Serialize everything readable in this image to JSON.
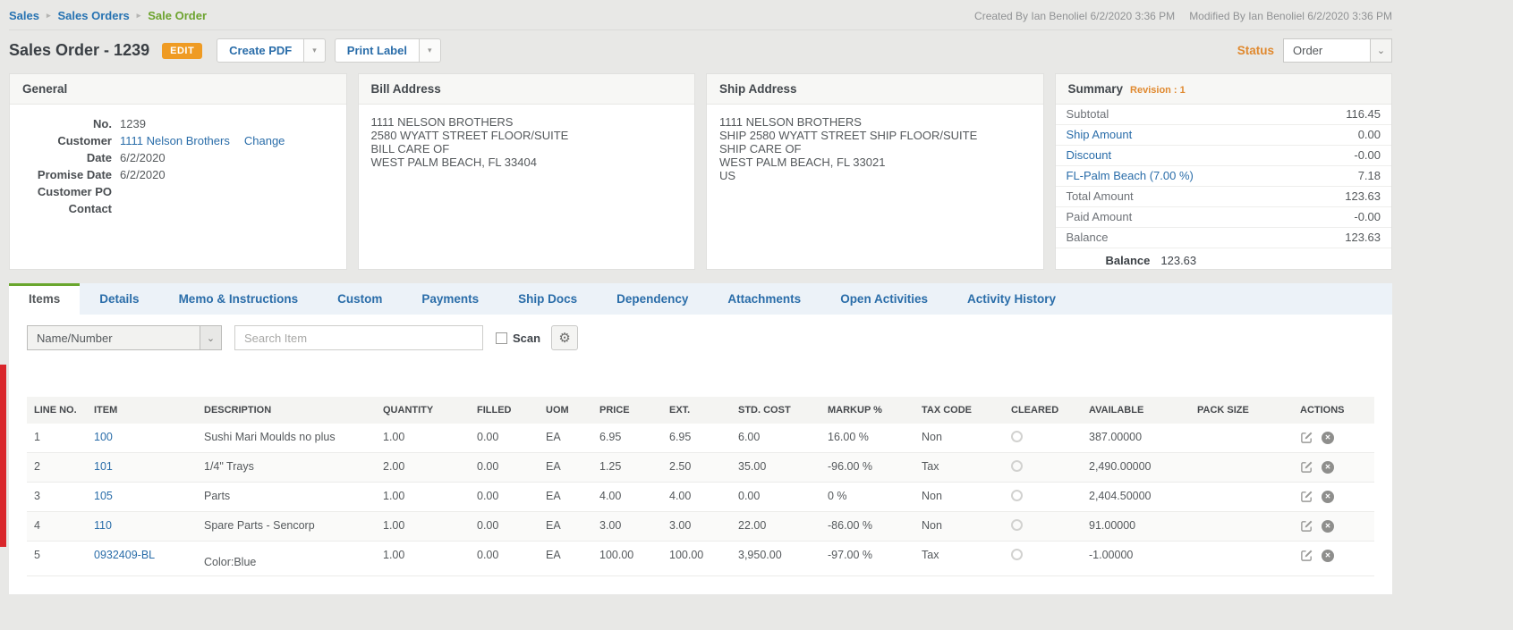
{
  "breadcrumb": {
    "items": [
      {
        "label": "Sales"
      },
      {
        "label": "Sales Orders"
      },
      {
        "label": "Sale Order"
      }
    ]
  },
  "meta": {
    "created": "Created By Ian Benoliel 6/2/2020 3:36 PM",
    "modified": "Modified By Ian Benoliel 6/2/2020 3:36 PM"
  },
  "header": {
    "title": "Sales Order - 1239",
    "edit_badge": "EDIT",
    "create_pdf_label": "Create PDF",
    "print_label_label": "Print Label",
    "status_label": "Status",
    "status_value": "Order"
  },
  "general": {
    "title": "General",
    "no": {
      "label": "No.",
      "value": "1239"
    },
    "customer": {
      "label": "Customer",
      "value": "1111 Nelson Brothers",
      "change_label": "Change"
    },
    "date": {
      "label": "Date",
      "value": "6/2/2020"
    },
    "promise_date": {
      "label": "Promise Date",
      "value": "6/2/2020"
    },
    "customer_po": {
      "label": "Customer PO",
      "value": ""
    },
    "contact": {
      "label": "Contact",
      "value": ""
    }
  },
  "bill_address": {
    "title": "Bill Address",
    "lines": [
      "1111 NELSON BROTHERS",
      "2580 WYATT STREET FLOOR/SUITE",
      "BILL CARE OF",
      "WEST PALM BEACH, FL 33404"
    ]
  },
  "ship_address": {
    "title": "Ship Address",
    "lines": [
      "1111 NELSON BROTHERS",
      "SHIP 2580 WYATT STREET SHIP FLOOR/SUITE",
      "SHIP CARE OF",
      "WEST PALM BEACH, FL 33021",
      "US"
    ]
  },
  "summary": {
    "title": "Summary",
    "revision": "Revision : 1",
    "rows": [
      {
        "label": "Subtotal",
        "value": "116.45",
        "link": false
      },
      {
        "label": "Ship Amount",
        "value": "0.00",
        "link": true
      },
      {
        "label": "Discount",
        "value": "-0.00",
        "link": true
      },
      {
        "label": "FL-Palm Beach (7.00 %)",
        "value": "7.18",
        "link": true
      },
      {
        "label": "Total Amount",
        "value": "123.63",
        "link": false
      },
      {
        "label": "Paid Amount",
        "value": "-0.00",
        "link": false
      },
      {
        "label": "Balance",
        "value": "123.63",
        "link": false
      }
    ],
    "balance_label": "Balance",
    "balance_value": "123.63"
  },
  "tabs": {
    "items": [
      {
        "label": "Items",
        "active": true
      },
      {
        "label": "Details",
        "active": false
      },
      {
        "label": "Memo & Instructions",
        "active": false
      },
      {
        "label": "Custom",
        "active": false
      },
      {
        "label": "Payments",
        "active": false
      },
      {
        "label": "Ship Docs",
        "active": false
      },
      {
        "label": "Dependency",
        "active": false
      },
      {
        "label": "Attachments",
        "active": false
      },
      {
        "label": "Open Activities",
        "active": false
      },
      {
        "label": "Activity History",
        "active": false
      }
    ]
  },
  "toolbar": {
    "filter_value": "Name/Number",
    "search_placeholder": "Search Item",
    "scan_label": "Scan"
  },
  "items_table": {
    "columns": [
      "LINE NO.",
      "ITEM",
      "DESCRIPTION",
      "QUANTITY",
      "FILLED",
      "UOM",
      "PRICE",
      "EXT.",
      "STD. COST",
      "MARKUP %",
      "TAX CODE",
      "CLEARED",
      "AVAILABLE",
      "PACK SIZE",
      "ACTIONS"
    ],
    "rows": [
      {
        "line_no": "1",
        "item": "100",
        "description": "Sushi Mari Moulds no plus",
        "description2": "",
        "quantity": "1.00",
        "filled": "0.00",
        "uom": "EA",
        "price": "6.95",
        "ext": "6.95",
        "std_cost": "6.00",
        "markup": "16.00 %",
        "tax_code": "Non",
        "available": "387.00000",
        "pack_size": ""
      },
      {
        "line_no": "2",
        "item": "101",
        "description": "1/4\" Trays",
        "description2": "",
        "quantity": "2.00",
        "filled": "0.00",
        "uom": "EA",
        "price": "1.25",
        "ext": "2.50",
        "std_cost": "35.00",
        "markup": "-96.00 %",
        "tax_code": "Tax",
        "available": "2,490.00000",
        "pack_size": ""
      },
      {
        "line_no": "3",
        "item": "105",
        "description": "Parts",
        "description2": "",
        "quantity": "1.00",
        "filled": "0.00",
        "uom": "EA",
        "price": "4.00",
        "ext": "4.00",
        "std_cost": "0.00",
        "markup": "0 %",
        "tax_code": "Non",
        "available": "2,404.50000",
        "pack_size": ""
      },
      {
        "line_no": "4",
        "item": "110",
        "description": "Spare Parts - Sencorp",
        "description2": "",
        "quantity": "1.00",
        "filled": "0.00",
        "uom": "EA",
        "price": "3.00",
        "ext": "3.00",
        "std_cost": "22.00",
        "markup": "-86.00 %",
        "tax_code": "Non",
        "available": "91.00000",
        "pack_size": ""
      },
      {
        "line_no": "5",
        "item": "0932409-BL",
        "description": "",
        "description2": "Color:Blue",
        "quantity": "1.00",
        "filled": "0.00",
        "uom": "EA",
        "price": "100.00",
        "ext": "100.00",
        "std_cost": "3,950.00",
        "markup": "-97.00 %",
        "tax_code": "Tax",
        "available": "-1.00000",
        "pack_size": ""
      }
    ]
  },
  "colors": {
    "accent_orange": "#ef9b23",
    "status_orange": "#e0892f",
    "link_blue": "#2a6da9",
    "breadcrumb_green": "#6da32f",
    "tab_active_green": "#69a62d",
    "alert_red": "#d9262b"
  },
  "icons": {
    "breadcrumb_separator": "breadcrumb-chevron-icon",
    "dropdown": "chevron-down-icon",
    "gear": "gear-icon",
    "edit": "edit-icon",
    "remove": "remove-icon",
    "cleared": "radio-circle-icon"
  }
}
